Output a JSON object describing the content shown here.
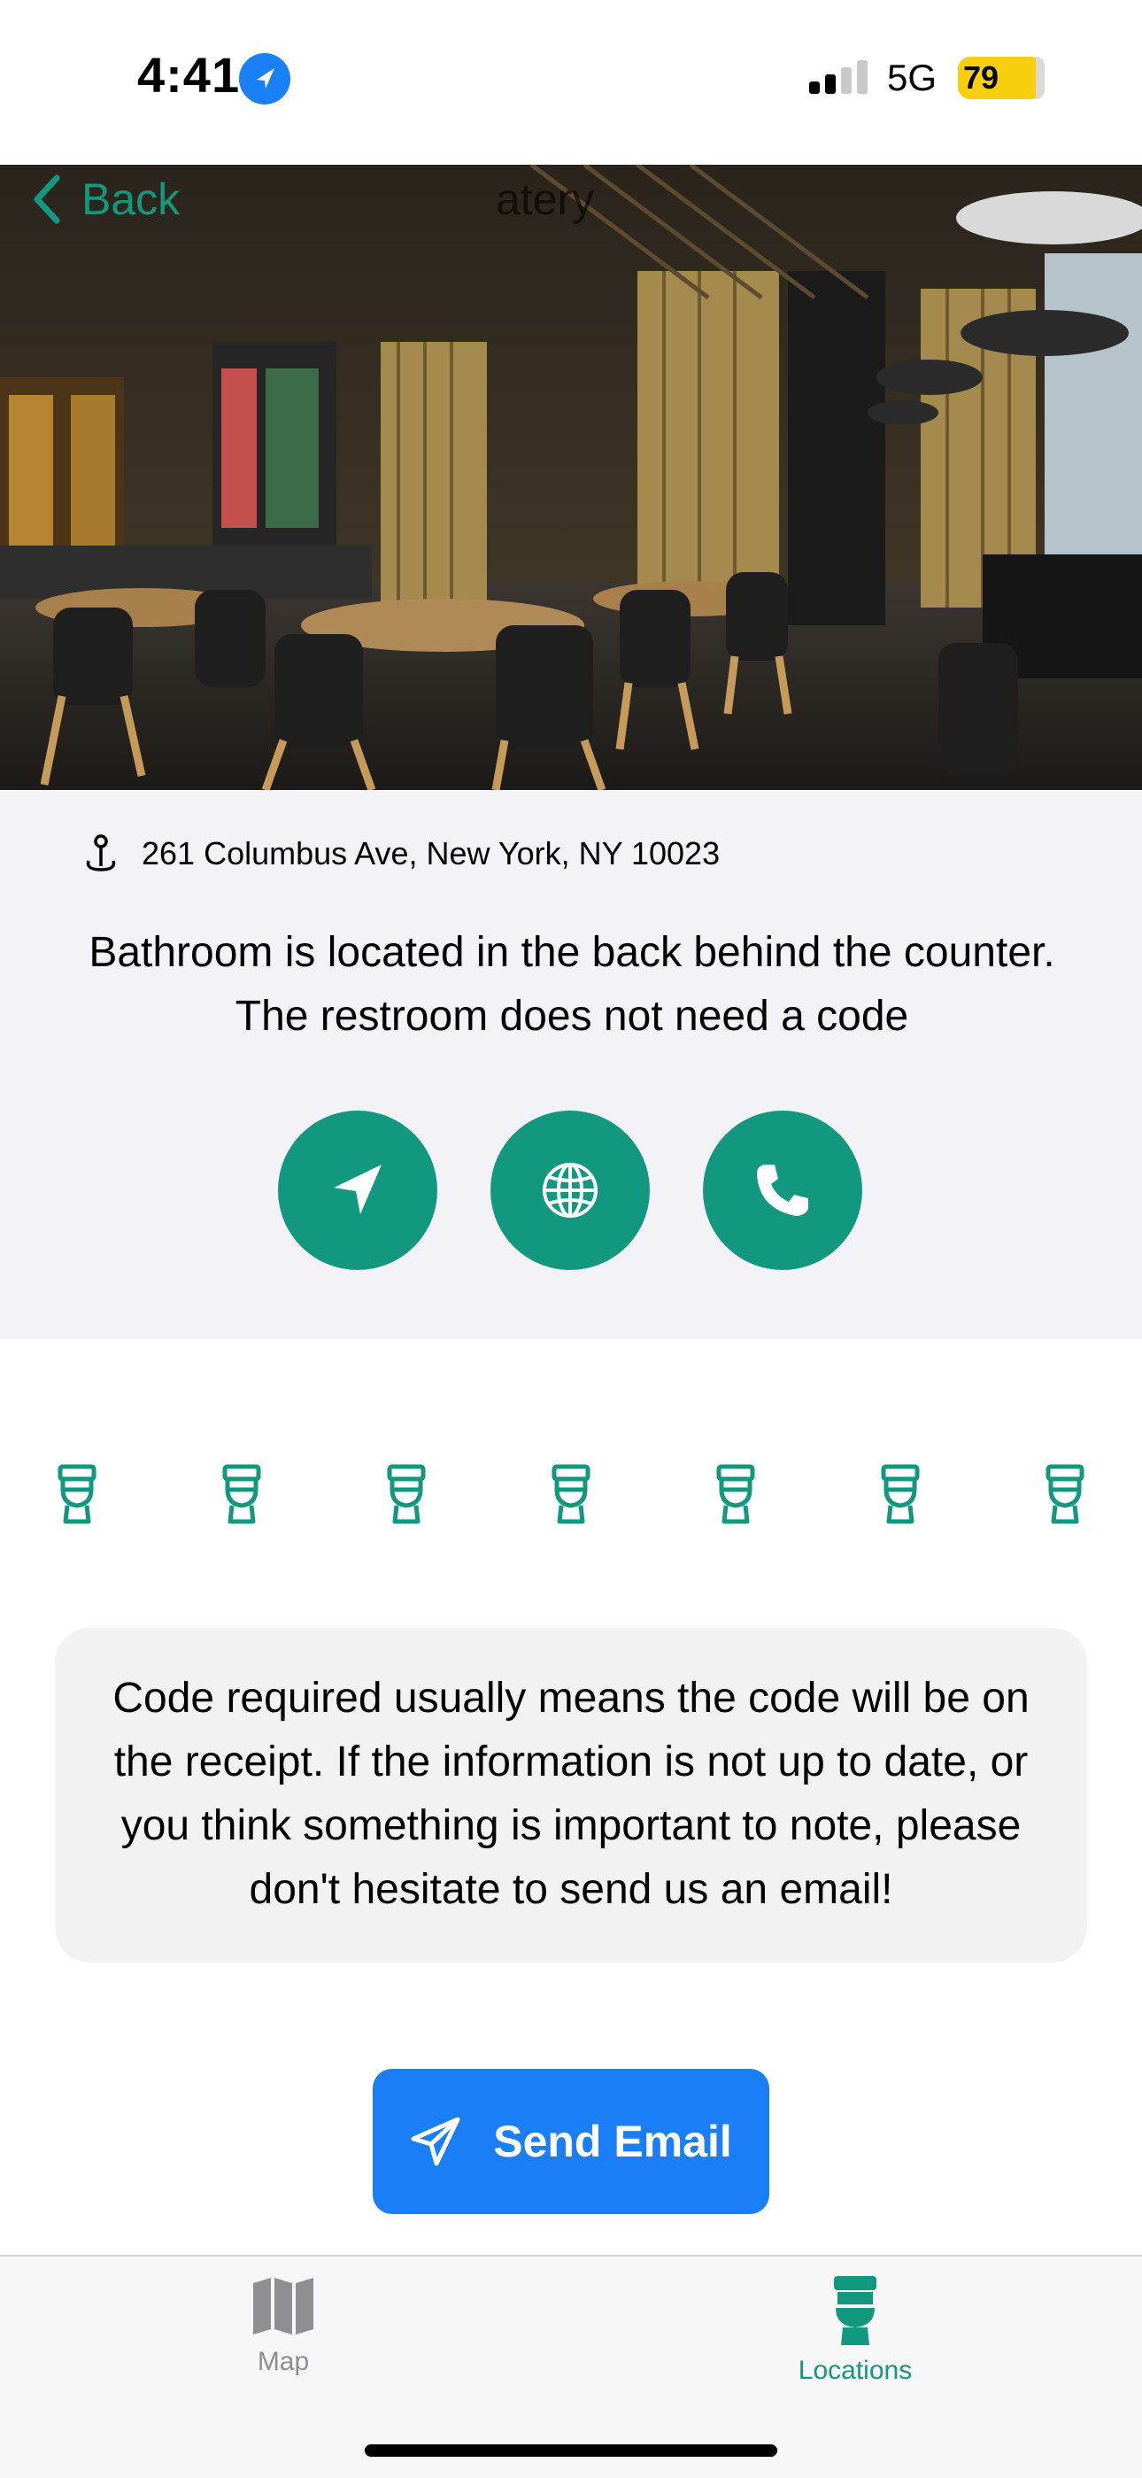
{
  "status_bar": {
    "time": "4:41",
    "network": "5G",
    "battery": "79"
  },
  "nav": {
    "back_label": "Back",
    "title": "atery"
  },
  "location": {
    "address": "261 Columbus Ave, New York, NY 10023",
    "description": "Bathroom is located in the back behind the counter. The restroom does not need a code"
  },
  "actions": [
    "navigate-icon",
    "globe-icon",
    "phone-icon"
  ],
  "rating": {
    "icon": "toilet-icon",
    "count": 7
  },
  "note": {
    "text": "Code required usually means the code will be on the receipt. If the information is not up to date, or you think something is important to note, please don't hesitate to send us an email!"
  },
  "email_button": {
    "label": "Send Email"
  },
  "tabs": [
    {
      "label": "Map",
      "icon": "map-icon",
      "active": false
    },
    {
      "label": "Locations",
      "icon": "toilet-icon",
      "active": true
    }
  ],
  "colors": {
    "accent": "#139880",
    "button_blue": "#1a7ef7",
    "info_bg": "#f2f2f7"
  }
}
